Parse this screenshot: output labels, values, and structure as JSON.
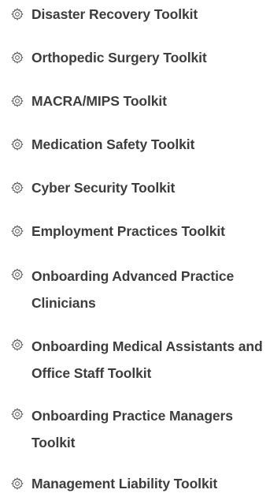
{
  "toolkits": {
    "items": [
      {
        "label": "Disaster Recovery Toolkit",
        "icon": "gear-icon"
      },
      {
        "label": "Orthopedic Surgery Toolkit",
        "icon": "gear-icon"
      },
      {
        "label": "MACRA/MIPS Toolkit",
        "icon": "gear-icon"
      },
      {
        "label": "Medication Safety Toolkit",
        "icon": "gear-icon"
      },
      {
        "label": "Cyber Security Toolkit",
        "icon": "gear-icon"
      },
      {
        "label": "Employment Practices Toolkit",
        "icon": "gear-icon"
      },
      {
        "label": "Onboarding Advanced Practice Clinicians",
        "icon": "gear-icon"
      },
      {
        "label": "Onboarding Medical Assistants and Office Staff Toolkit",
        "icon": "gear-icon"
      },
      {
        "label": "Onboarding Practice Managers Toolkit",
        "icon": "gear-icon"
      },
      {
        "label": "Management Liability Toolkit",
        "icon": "gear-icon"
      }
    ]
  },
  "colors": {
    "text": "#3d3d3d",
    "icon": "#555555"
  }
}
